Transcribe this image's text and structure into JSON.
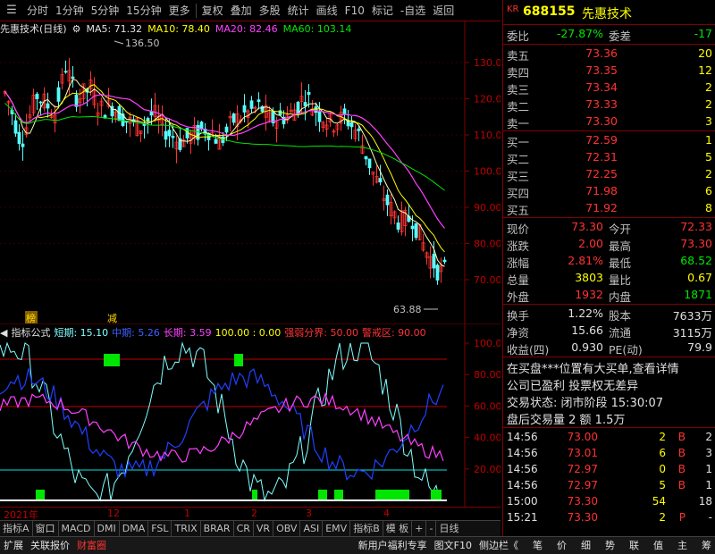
{
  "toolbar": {
    "items": [
      "分时",
      "1分钟",
      "5分钟",
      "15分钟",
      "更多",
      "复权",
      "叠加",
      "多股",
      "统计",
      "画线",
      "F10",
      "标记",
      "-自选",
      "返回"
    ]
  },
  "main": {
    "stock_label": "先惠技术(日线)",
    "ma5": "MA5: 71.32",
    "ma10": "MA10: 78.40",
    "ma20": "MA20: 82.46",
    "ma60": "MA60: 103.14",
    "high_label": "136.50",
    "low_label": "63.88",
    "yticks": [
      "130.0",
      "120.0",
      "110.0",
      "100.0",
      "90.00",
      "80.00",
      "70.00"
    ],
    "marks": [
      "榜",
      "减"
    ]
  },
  "indicator": {
    "name": "指标公式",
    "short": "短期: 15.10",
    "mid": "中期: 5.26",
    "long": "长期: 3.59",
    "vals": "100.00 : 0.00",
    "strong": "强弱分界: 50.00",
    "alert": "警戒区: 90.00",
    "yticks": [
      "100.0",
      "80.00",
      "60.00",
      "40.00",
      "20.00"
    ]
  },
  "dates": [
    "2021年",
    "12",
    "1",
    "2",
    "3",
    "4"
  ],
  "tabs": [
    "指标A",
    "窗口",
    "MACD",
    "DMI",
    "DMA",
    "FSL",
    "TRIX",
    "BRAR",
    "CR",
    "VR",
    "OBV",
    "ASI",
    "EMV",
    "指标B",
    "模 板",
    "+",
    "-",
    "日线"
  ],
  "statusbar": {
    "left": [
      "扩展",
      "关联报价",
      "财富圈"
    ],
    "mid": [
      "新用户福利专享",
      "图文F10",
      "侧边栏《"
    ],
    "right": [
      "笔",
      "价",
      "细",
      "势",
      "联",
      "值",
      "主",
      "筹"
    ]
  },
  "quote": {
    "code": "688155",
    "name": "先惠技术",
    "kr": "KR",
    "webi_label": "委比",
    "webi": "-27.87%",
    "weicha_label": "委差",
    "weicha": "-17",
    "sells": [
      {
        "label": "卖五",
        "price": "73.36",
        "vol": "20"
      },
      {
        "label": "卖四",
        "price": "73.35",
        "vol": "12"
      },
      {
        "label": "卖三",
        "price": "73.34",
        "vol": "2"
      },
      {
        "label": "卖二",
        "price": "73.33",
        "vol": "2"
      },
      {
        "label": "卖一",
        "price": "73.30",
        "vol": "3"
      }
    ],
    "buys": [
      {
        "label": "买一",
        "price": "72.59",
        "vol": "1"
      },
      {
        "label": "买二",
        "price": "72.31",
        "vol": "5"
      },
      {
        "label": "买三",
        "price": "72.25",
        "vol": "2"
      },
      {
        "label": "买四",
        "price": "71.98",
        "vol": "6"
      },
      {
        "label": "买五",
        "price": "71.92",
        "vol": "8"
      }
    ],
    "stats": [
      {
        "l1": "现价",
        "v1": "73.30",
        "c1": "red",
        "l2": "今开",
        "v2": "72.33",
        "c2": "red"
      },
      {
        "l1": "涨跌",
        "v1": "2.00",
        "c1": "red",
        "l2": "最高",
        "v2": "73.30",
        "c2": "red"
      },
      {
        "l1": "涨幅",
        "v1": "2.81%",
        "c1": "red",
        "l2": "最低",
        "v2": "68.52",
        "c2": "green"
      },
      {
        "l1": "总量",
        "v1": "3803",
        "c1": "yellow",
        "l2": "量比",
        "v2": "0.67",
        "c2": "yellow"
      },
      {
        "l1": "外盘",
        "v1": "1932",
        "c1": "red",
        "l2": "内盘",
        "v2": "1871",
        "c2": "green"
      }
    ],
    "stats2": [
      {
        "l1": "换手",
        "v1": "1.22%",
        "l2": "股本",
        "v2": "7633万"
      },
      {
        "l1": "净资",
        "v1": "15.66",
        "l2": "流通",
        "v2": "3115万"
      },
      {
        "l1": "收益(四)",
        "v1": "0.930",
        "l2": "PE(动)",
        "v2": "79.9"
      }
    ],
    "news": [
      "在买盘***位置有大买单,查看详情",
      "公司已盈利 投票权无差异"
    ],
    "trade_status": "交易状态: 闭市阶段 15:30:07",
    "after_hours": "盘后交易量 2 额 1.5万",
    "ticks": [
      {
        "t": "14:56",
        "p": "73.00",
        "v": "2",
        "d": "B",
        "n": "2"
      },
      {
        "t": "14:56",
        "p": "73.01",
        "v": "6",
        "d": "B",
        "n": "3"
      },
      {
        "t": "14:56",
        "p": "72.97",
        "v": "0",
        "d": "B",
        "n": "1"
      },
      {
        "t": "14:56",
        "p": "72.97",
        "v": "5",
        "d": "B",
        "n": "1"
      },
      {
        "t": "15:00",
        "p": "73.30",
        "v": "54",
        "d": "",
        "n": "18"
      },
      {
        "t": "15:21",
        "p": "73.30",
        "v": "2",
        "d": "P",
        "n": "-"
      }
    ]
  }
}
